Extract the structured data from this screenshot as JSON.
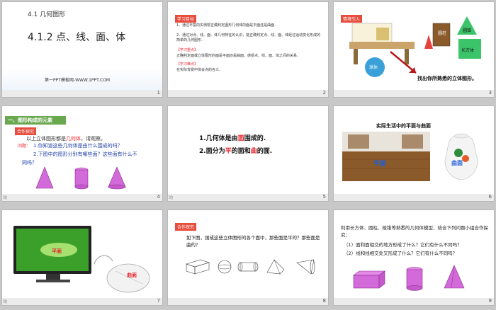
{
  "slides": [
    {
      "num": "1",
      "chapter": "4.1  几何图形",
      "title": "4.1.2  点、线、面、体",
      "footer": "第一PPT模板网-WWW.1PPT.COM"
    },
    {
      "num": "2",
      "tag1": "学习目标",
      "goal1": "1．通过丰富的实例帮正确判定图形几何体的面是平面还是曲面．",
      "goal2": "2．通过对点、线、面、体几何特征的认识，能正确判定点、线、面、体经过运动变化形成的简单的几何图形．",
      "tag2": "【学习重点】",
      "focus": "正确判定面或立体图形的面是平面还是曲面，感受点、线、面、体之间的关系．",
      "tag3": "【学习难点】",
      "difficulty": "在实际背景中体会点的含义．"
    },
    {
      "num": "3",
      "tag": "情境引入",
      "label_cylinder": "圆柱",
      "label_cone": "圆锥",
      "label_cuboid": "长方体",
      "label_sphere": "球体",
      "prompt": "找出你所熟悉的立体图形。"
    },
    {
      "num": "4",
      "header": "一、图形构成的元素",
      "tag": "合作探究",
      "line1_a": "以上立体图形都是",
      "line1_b": "几何体",
      "line1_c": "，请观察",
      "line1_d": "。",
      "q_label": "问题：",
      "q1": "1.你知道这些几何体是由什么围成的吗？",
      "q2": "2.下图中的图形分别有哪些面？这些面有什么不",
      "q2b": "同吗？"
    },
    {
      "num": "5",
      "p1_a": "1.几何体是由",
      "p1_b": "面",
      "p1_c": "围成的.",
      "p2_a": "2.面分为",
      "p2_b": "平",
      "p2_c": "的面和",
      "p2_d": "曲",
      "p2_e": "的面."
    },
    {
      "num": "6",
      "title": "实际生活中的平面与曲面",
      "plane": "平面",
      "curve": "曲面"
    },
    {
      "num": "7",
      "plane": "平面",
      "curve": "曲面"
    },
    {
      "num": "8",
      "tag": "合作探究",
      "q": "如下图，围成这些立体图形的各个面中，那些面是平的？那些面是曲的？"
    },
    {
      "num": "9",
      "p": "利用长方体、圆柱、棱锥等熟悉的几何体模型，结合下列问题小组合作探究：",
      "q1": "（1）面和面相交的地方形成了什么？它们有什么不同吗？",
      "q2": "（2）线和线相交处又形成了什么？它们有什么不同吗？"
    }
  ],
  "anim_label": "动",
  "colors": {
    "accent_red": "#e8232a",
    "accent_blue": "#1f3fa6",
    "violet": "#d36ad9",
    "green": "#6aa84f"
  }
}
